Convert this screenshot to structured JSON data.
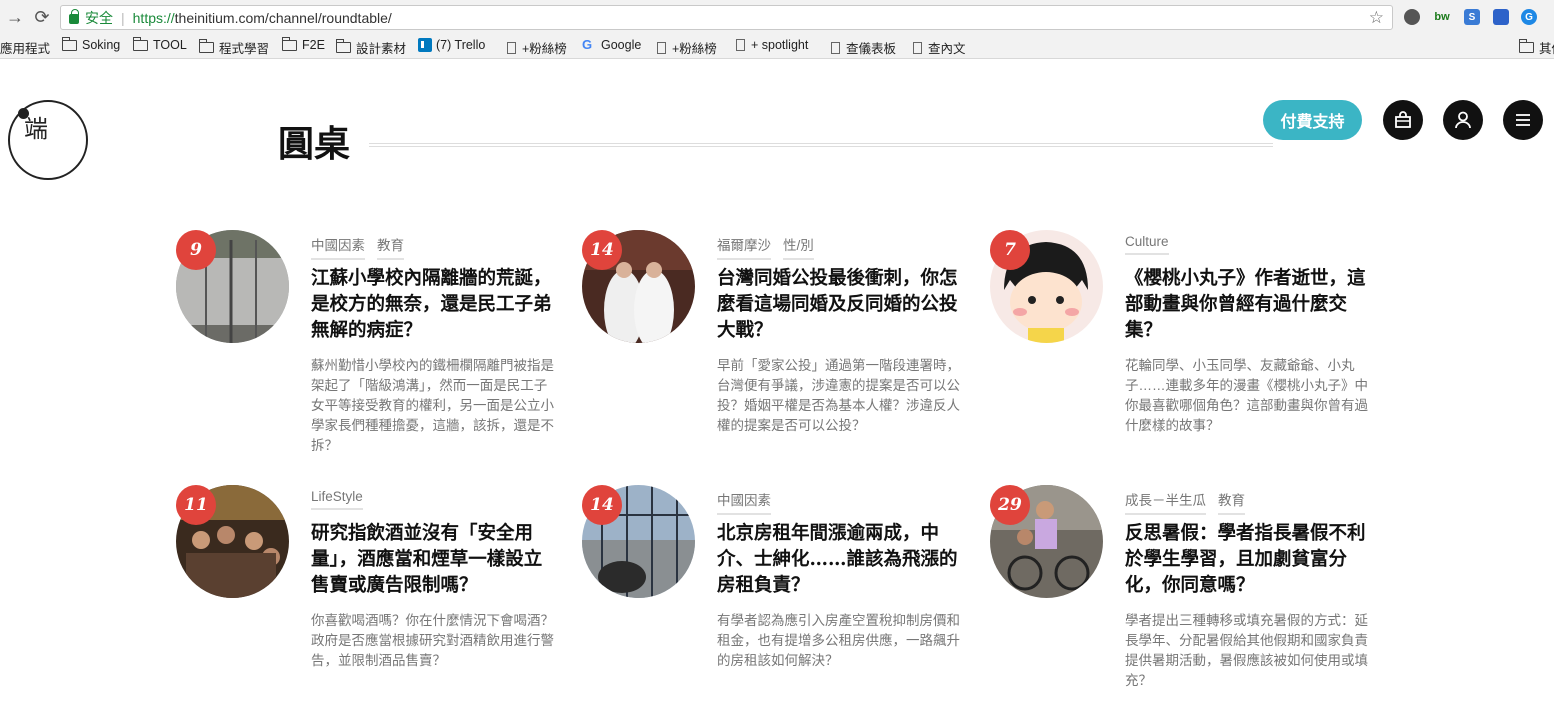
{
  "browser": {
    "secure_label": "安全",
    "url_proto": "https://",
    "url_rest": "theinitium.com/channel/roundtable/"
  },
  "bookmarks": {
    "apps": "應用程式",
    "items": [
      "Soking",
      "TOOL",
      "程式學習",
      "F2E",
      "設計素材",
      "(7) Trello",
      "+粉絲榜",
      "Google",
      "+粉絲榜",
      "+ spotlight",
      "查儀表板",
      "查內文"
    ],
    "other": "其他"
  },
  "site": {
    "logo_text": "端",
    "page_title": "圓桌",
    "support_label": "付費支持"
  },
  "articles": [
    {
      "count": "9",
      "tags": [
        "中國因素",
        "教育"
      ],
      "headline": "江蘇小學校內隔離牆的荒誕，是校方的無奈，還是民工子弟無解的病症？",
      "summary": "蘇州勤惜小學校內的鐵柵欄隔離門被指是架起了「階級鴻溝」，然而一面是民工子女平等接受教育的權利，另一面是公立小學家長們種種擔憂，這牆，該拆，還是不拆？"
    },
    {
      "count": "14",
      "tags": [
        "福爾摩沙",
        "性/別"
      ],
      "headline": "台灣同婚公投最後衝刺，你怎麼看這場同婚及反同婚的公投大戰？",
      "summary": "早前「愛家公投」通過第一階段連署時，台灣便有爭議，涉違憲的提案是否可以公投？婚姻平權是否為基本人權？涉違反人權的提案是否可以公投？"
    },
    {
      "count": "7",
      "tags": [
        "Culture"
      ],
      "headline": "《櫻桃小丸子》作者逝世，這部動畫與你曾經有過什麼交集？",
      "summary": "花輪同學、小玉同學、友藏爺爺、小丸子……連載多年的漫畫《櫻桃小丸子》中你最喜歡哪個角色？這部動畫與你曾有過什麼樣的故事？"
    },
    {
      "count": "11",
      "tags": [
        "LifeStyle"
      ],
      "headline": "研究指飲酒並沒有「安全用量」，酒應當和煙草一樣設立售賣或廣告限制嗎？",
      "summary": "你喜歡喝酒嗎？你在什麼情況下會喝酒？政府是否應當根據研究對酒精飲用進行警告，並限制酒品售賣？"
    },
    {
      "count": "14",
      "tags": [
        "中國因素"
      ],
      "headline": "北京房租年間漲逾兩成，中介、士紳化……誰該為飛漲的房租負責？",
      "summary": "有學者認為應引入房產空置稅抑制房價和租金，也有提增多公租房供應，一路飆升的房租該如何解決？"
    },
    {
      "count": "29",
      "tags": [
        "成長－半生瓜",
        "教育"
      ],
      "headline": "反思暑假：學者指長暑假不利於學生學習，且加劇貧富分化，你同意嗎？",
      "summary": "學者提出三種轉移或填充暑假的方式：延長學年、分配暑假給其他假期和國家負責提供暑期活動，暑假應該被如何使用或填充？"
    }
  ]
}
